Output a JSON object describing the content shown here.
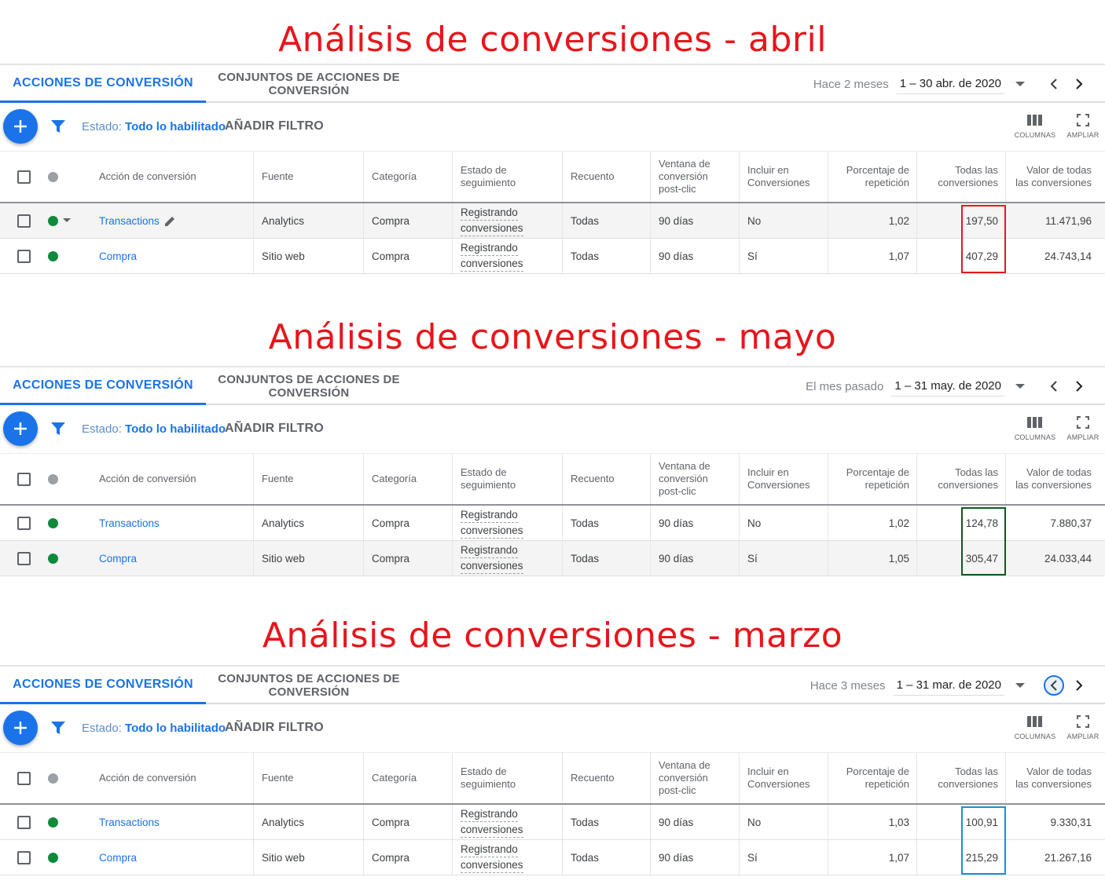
{
  "panels": [
    {
      "heading": "Análisis de conversiones - abril",
      "tabs": {
        "active": "ACCIONES DE CONVERSIÓN",
        "inactive": "CONJUNTOS DE ACCIONES DE CONVERSIÓN"
      },
      "date_range": {
        "label": "Hace 2 meses",
        "value": "1 – 30 abr. de 2020"
      },
      "filter": {
        "label": "Estado:",
        "value": "Todo lo habilitado",
        "add": "AÑADIR FILTRO"
      },
      "tools": {
        "columns": "COLUMNAS",
        "expand": "AMPLIAR"
      },
      "highlight_color": "#e0191f",
      "rows": [
        {
          "action": "Transactions",
          "source": "Analytics",
          "category": "Compra",
          "status_1": "Registrando",
          "status_2": "conversiones",
          "count": "Todas",
          "window": "90 días",
          "include": "No",
          "repeat": "1,02",
          "all_conv": "197,50",
          "all_value": "11.471,96"
        },
        {
          "action": "Compra",
          "source": "Sitio web",
          "category": "Compra",
          "status_1": "Registrando",
          "status_2": "conversiones",
          "count": "Todas",
          "window": "90 días",
          "include": "Sí",
          "repeat": "1,07",
          "all_conv": "407,29",
          "all_value": "24.743,14"
        }
      ]
    },
    {
      "heading": "Análisis de conversiones - mayo",
      "tabs": {
        "active": "ACCIONES DE CONVERSIÓN",
        "inactive": "CONJUNTOS DE ACCIONES DE CONVERSIÓN"
      },
      "date_range": {
        "label": "El mes pasado",
        "value": "1 – 31 may. de 2020"
      },
      "filter": {
        "label": "Estado:",
        "value": "Todo lo habilitado",
        "add": "AÑADIR FILTRO"
      },
      "tools": {
        "columns": "COLUMNAS",
        "expand": "AMPLIAR"
      },
      "highlight_color": "#0b5a1f",
      "rows": [
        {
          "action": "Transactions",
          "source": "Analytics",
          "category": "Compra",
          "status_1": "Registrando",
          "status_2": "conversiones",
          "count": "Todas",
          "window": "90 días",
          "include": "No",
          "repeat": "1,02",
          "all_conv": "124,78",
          "all_value": "7.880,37"
        },
        {
          "action": "Compra",
          "source": "Sitio web",
          "category": "Compra",
          "status_1": "Registrando",
          "status_2": "conversiones",
          "count": "Todas",
          "window": "90 días",
          "include": "Sí",
          "repeat": "1,05",
          "all_conv": "305,47",
          "all_value": "24.033,44"
        }
      ]
    },
    {
      "heading": "Análisis de conversiones - marzo",
      "tabs": {
        "active": "ACCIONES DE CONVERSIÓN",
        "inactive": "CONJUNTOS DE ACCIONES DE CONVERSIÓN"
      },
      "date_range": {
        "label": "Hace 3 meses",
        "value": "1 – 31 mar. de 2020"
      },
      "filter": {
        "label": "Estado:",
        "value": "Todo lo habilitado",
        "add": "AÑADIR FILTRO"
      },
      "tools": {
        "columns": "COLUMNAS",
        "expand": "AMPLIAR"
      },
      "highlight_color": "#1a8fd6",
      "rows": [
        {
          "action": "Transactions",
          "source": "Analytics",
          "category": "Compra",
          "status_1": "Registrando",
          "status_2": "conversiones",
          "count": "Todas",
          "window": "90 días",
          "include": "No",
          "repeat": "1,03",
          "all_conv": "100,91",
          "all_value": "9.330,31"
        },
        {
          "action": "Compra",
          "source": "Sitio web",
          "category": "Compra",
          "status_1": "Registrando",
          "status_2": "conversiones",
          "count": "Todas",
          "window": "90 días",
          "include": "Sí",
          "repeat": "1,07",
          "all_conv": "215,29",
          "all_value": "21.267,16"
        }
      ]
    }
  ],
  "columns": {
    "action": "Acción de conversión",
    "source": "Fuente",
    "category": "Categoría",
    "status": "Estado de seguimiento",
    "count": "Recuento",
    "window": "Ventana de conversión post-clic",
    "include": "Incluir en Conversiones",
    "repeat": "Porcentaje de repetición",
    "all_conv": "Todas las conversiones",
    "all_value": "Valor de todas las conversiones"
  }
}
